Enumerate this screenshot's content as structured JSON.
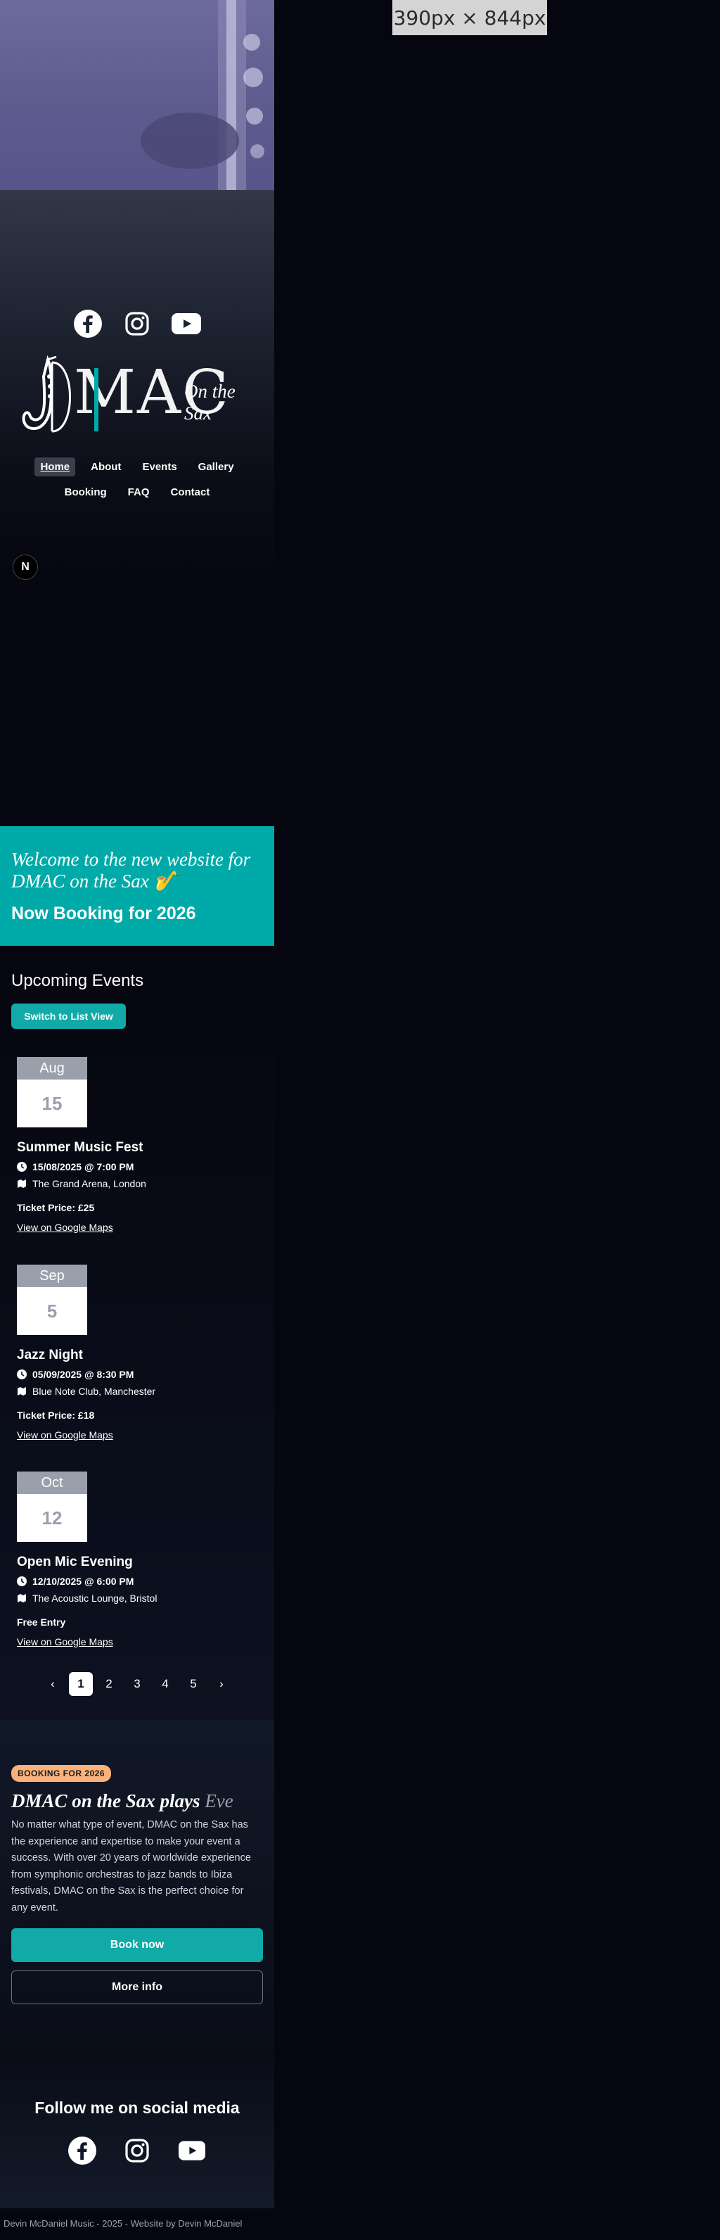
{
  "viewport_label": "390px × 844px",
  "nav": {
    "row1": [
      "Home",
      "About",
      "Events",
      "Gallery"
    ],
    "row2": [
      "Booking",
      "FAQ",
      "Contact"
    ],
    "active": "Home"
  },
  "logo": {
    "mac": "MAC",
    "sub": "On the Sax"
  },
  "badge_letter": "N",
  "icons": {
    "social": [
      "facebook-icon",
      "instagram-icon",
      "youtube-icon"
    ],
    "clock": "clock-icon",
    "venue": "map-icon"
  },
  "welcome": {
    "title": "Welcome to the new website for DMAC on the Sax 🎷",
    "booking": "Now Booking for 2026"
  },
  "events": {
    "title": "Upcoming Events",
    "switch_label": "Switch to List View",
    "items": [
      {
        "month": "Aug",
        "day": "15",
        "name": "Summer Music Fest",
        "datetime": "15/08/2025 @ 7:00 PM",
        "venue": "The Grand Arena, London",
        "price": "Ticket Price: £25",
        "map": "View on Google Maps"
      },
      {
        "month": "Sep",
        "day": "5",
        "name": "Jazz Night",
        "datetime": "05/09/2025 @ 8:30 PM",
        "venue": "Blue Note Club, Manchester",
        "price": "Ticket Price: £18",
        "map": "View on Google Maps"
      },
      {
        "month": "Oct",
        "day": "12",
        "name": "Open Mic Evening",
        "datetime": "12/10/2025 @ 6:00 PM",
        "venue": "The Acoustic Lounge, Bristol",
        "price": "Free Entry",
        "map": "View on Google Maps"
      }
    ],
    "pager": {
      "prev": "‹",
      "pages": [
        "1",
        "2",
        "3",
        "4",
        "5"
      ],
      "current": "1",
      "next": "›"
    }
  },
  "booking": {
    "chip": "BOOKING FOR 2026",
    "title": "DMAC on the Sax plays",
    "title_word": "Eve",
    "text": "No matter what type of event, DMAC on the Sax has the experience and expertise to make your event a success. With over 20 years of worldwide experience from symphonic orchestras to jazz bands to Ibiza festivals, DMAC on the Sax is the perfect choice for any event.",
    "book_now": "Book now",
    "more_info": "More info"
  },
  "social": {
    "title": "Follow me on social media"
  },
  "footer": {
    "text": "Devin McDaniel Music - 2025 - Website by Devin McDaniel"
  },
  "colors": {
    "accent": "#00aaa8",
    "chip": "#f9b27a",
    "background": "#05060f"
  }
}
